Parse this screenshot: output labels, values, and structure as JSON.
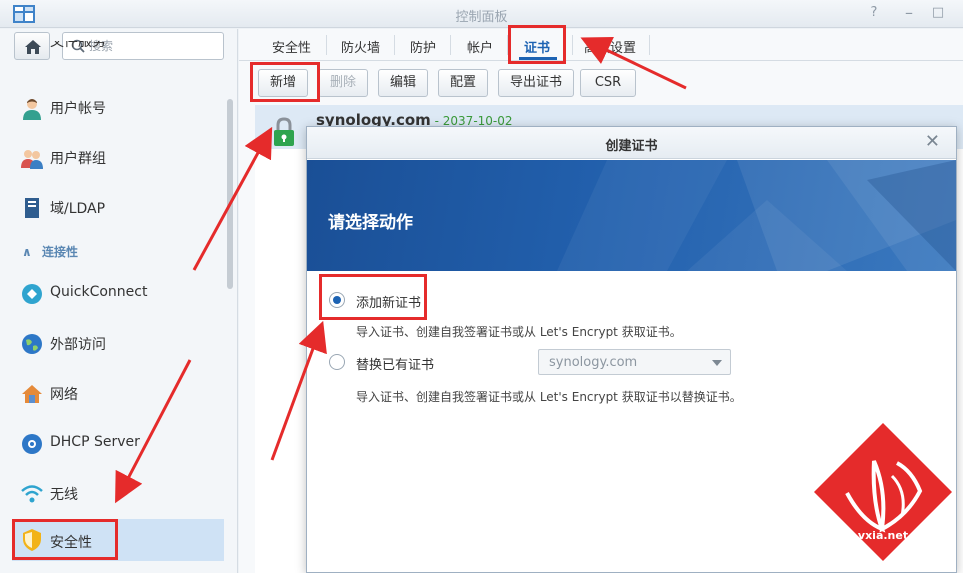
{
  "window": {
    "title": "控制面板",
    "help_glyph": "?",
    "close_glyph": "□"
  },
  "sidebar": {
    "search_placeholder": "搜索",
    "items_top": [
      {
        "label": "文件服务",
        "icon": "file-service-icon"
      },
      {
        "label": "用户帐号",
        "icon": "user-icon"
      },
      {
        "label": "用户群组",
        "icon": "group-icon"
      },
      {
        "label": "域/LDAP",
        "icon": "domain-icon"
      }
    ],
    "section_label": "连接性",
    "section_glyph": "∧",
    "items_connectivity": [
      {
        "label": "QuickConnect",
        "icon": "quickconnect-icon"
      },
      {
        "label": "外部访问",
        "icon": "globe-icon"
      },
      {
        "label": "网络",
        "icon": "network-icon"
      },
      {
        "label": "DHCP Server",
        "icon": "dhcp-icon"
      },
      {
        "label": "无线",
        "icon": "wifi-icon"
      },
      {
        "label": "安全性",
        "icon": "shield-icon"
      }
    ]
  },
  "tabs": [
    "安全性",
    "防火墙",
    "防护",
    "帐户",
    "证书",
    "高级设置"
  ],
  "active_tab": "证书",
  "toolbar": {
    "add": "新增",
    "delete": "删除",
    "edit": "编辑",
    "configure": "配置",
    "export": "导出证书",
    "csr": "CSR"
  },
  "certificate": {
    "name": "synology.com",
    "separator": " - ",
    "expiry": "2037-10-02"
  },
  "dialog": {
    "title": "创建证书",
    "close_glyph": "✕",
    "heading": "请选择动作",
    "option1_label": "添加新证书",
    "option1_desc": "导入证书、创建自我签署证书或从 Let's Encrypt 获取证书。",
    "option2_label": "替换已有证书",
    "option2_select": "synology.com",
    "option2_desc": "导入证书、创建自我签署证书或从 Let's Encrypt 获取证书以替换证书。"
  },
  "watermark": "vxia.net",
  "colors": {
    "accent": "#1d63b3",
    "annotation": "#e52b2b",
    "banner": "#2260ad",
    "date": "#3a9a3a"
  }
}
